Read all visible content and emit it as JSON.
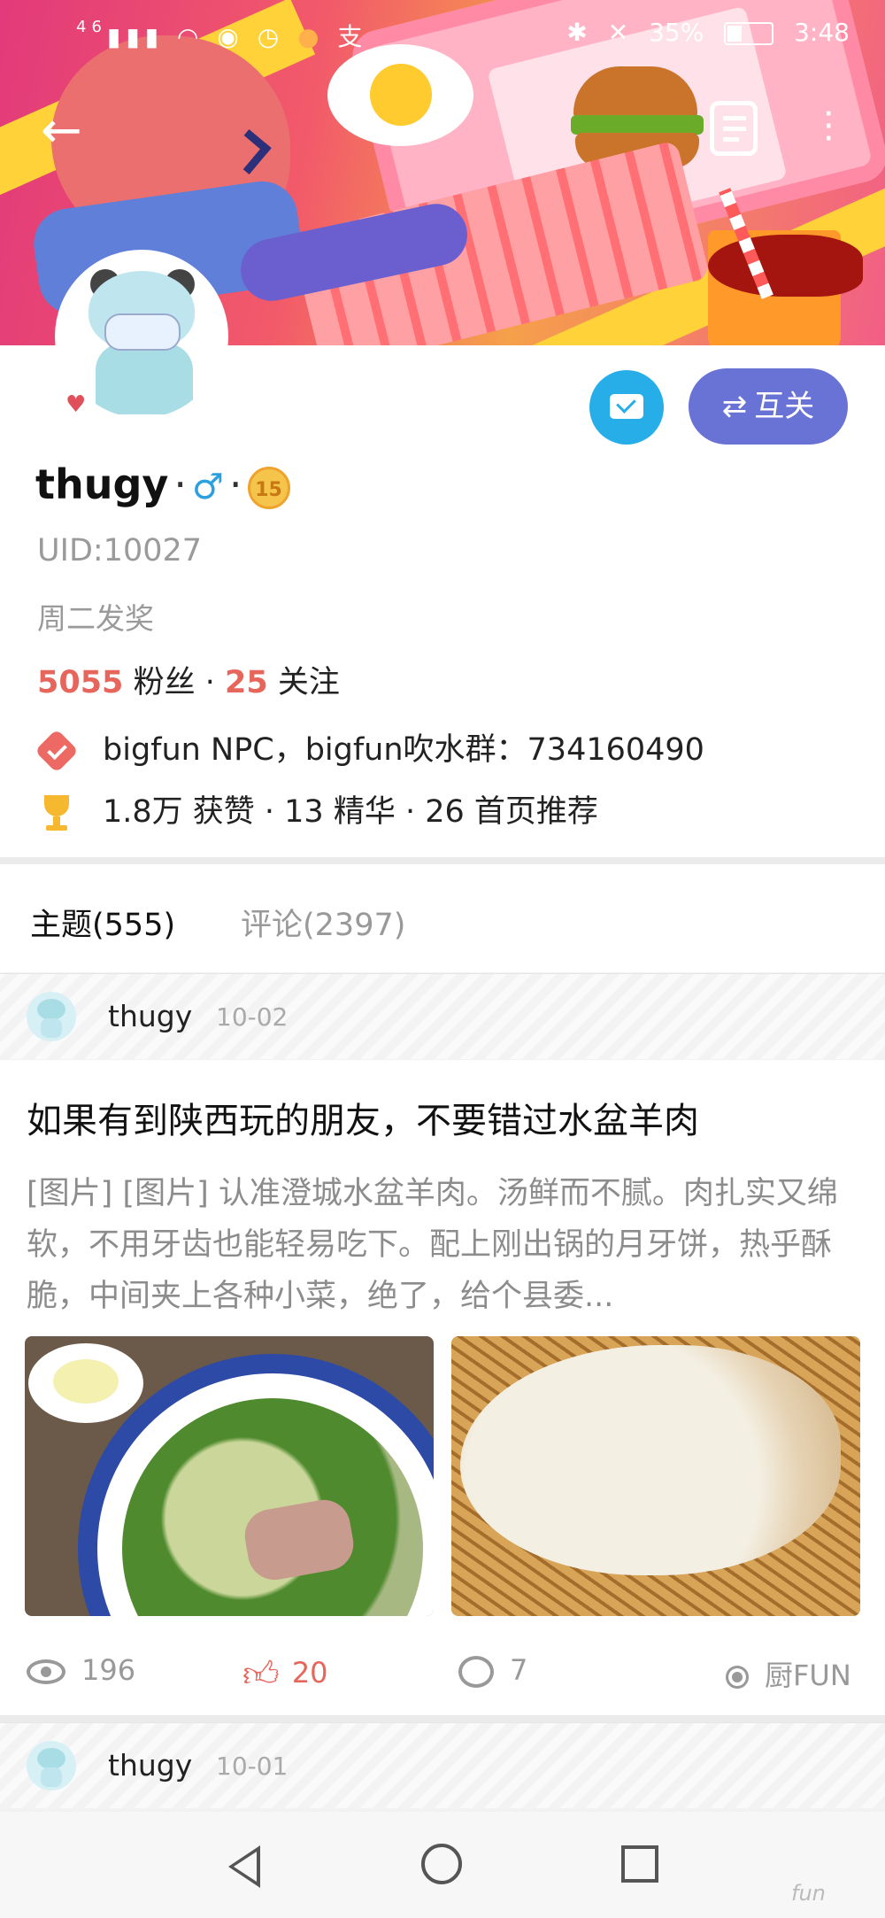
{
  "status_bar": {
    "signal": "46",
    "battery": "35%",
    "time": "3:48"
  },
  "header": {
    "back_icon": "arrow-left-icon",
    "doc_icon": "document-icon",
    "more_icon": "more-vertical-icon"
  },
  "profile": {
    "username": "thugy",
    "gender_symbol": "♂",
    "level": "15",
    "uid": "UID:10027",
    "bio": "周二发奖",
    "followers_count": "5055",
    "followers_label": "粉丝",
    "following_count": "25",
    "following_label": "关注",
    "verified_text": "bigfun NPC，bigfun吹水群：734160490",
    "achievements": "1.8万 获赞 · 13 精华 · 26 首页推荐",
    "follow_button": "互关",
    "follow_icon": "⇄"
  },
  "tabs": [
    {
      "label": "主题(555)",
      "active": true
    },
    {
      "label": "评论(2397)",
      "active": false
    }
  ],
  "posts": [
    {
      "author": "thugy",
      "date": "10-02",
      "title": "如果有到陕西玩的朋友，不要错过水盆羊肉",
      "excerpt": "[图片] [图片] 认准澄城水盆羊肉。汤鲜而不腻。肉扎实又绵软，不用牙齿也能轻易吃下。配上刚出锅的月牙饼，热乎酥脆，中间夹上各种小菜，绝了，给个县委...",
      "views": "196",
      "likes": "20",
      "comments": "7",
      "category": "厨FUN"
    },
    {
      "author": "thugy",
      "date": "10-01"
    }
  ],
  "watermark": "fun"
}
